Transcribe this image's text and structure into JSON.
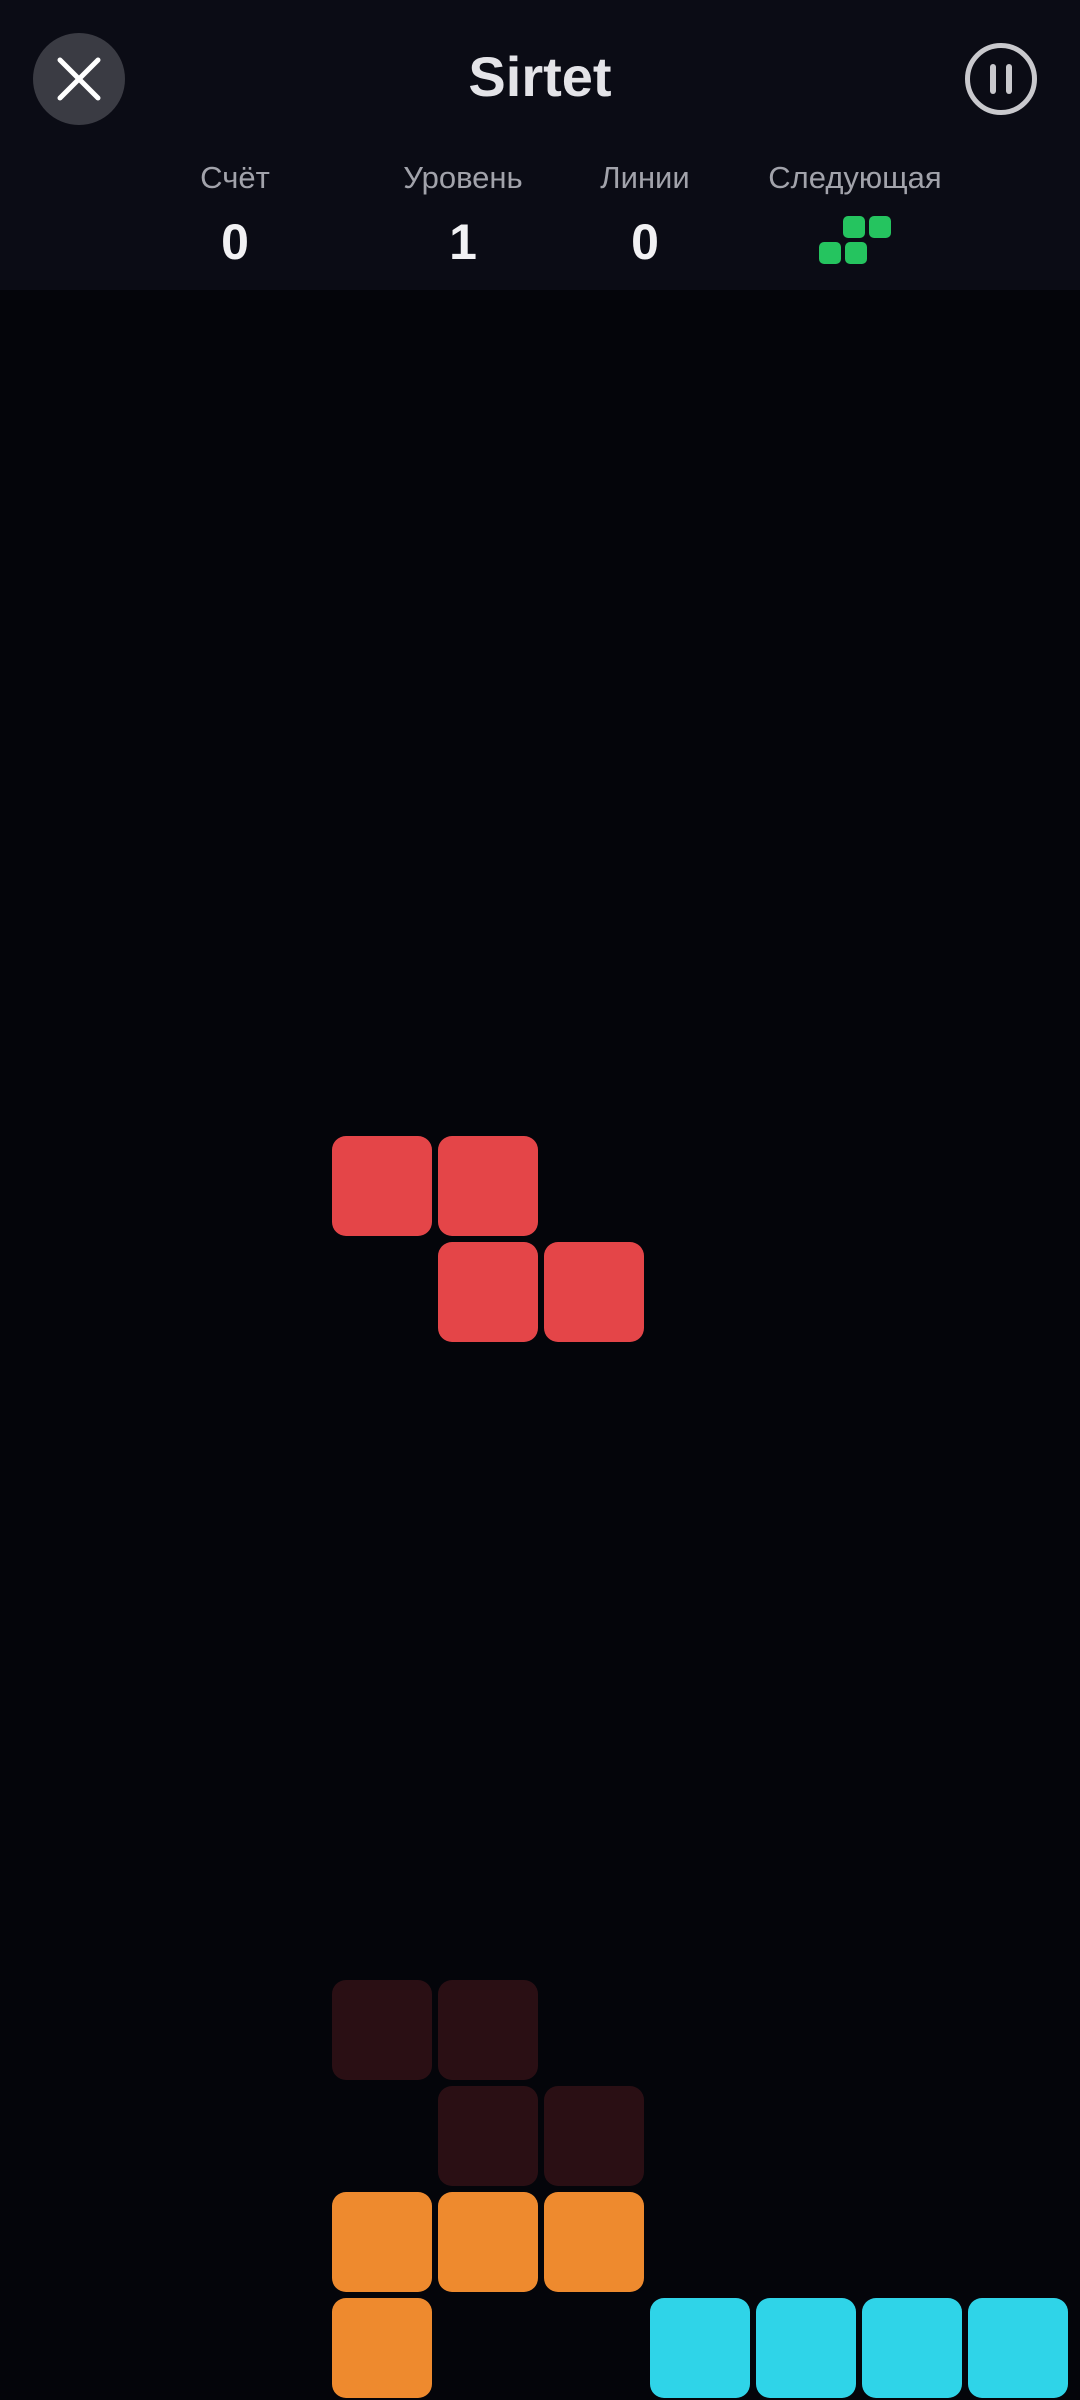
{
  "app": {
    "title": "Sirtet"
  },
  "header": {
    "close_icon": "close-icon",
    "pause_icon": "pause-icon"
  },
  "stats": [
    {
      "label": "Счёт",
      "value": "0"
    },
    {
      "label": "Уровень",
      "value": "1"
    },
    {
      "label": "Линии",
      "value": "0"
    },
    {
      "label": "Следующая"
    }
  ],
  "next_piece": {
    "shape": "S",
    "color": "#25c45f"
  },
  "board": {
    "columns": 10,
    "active_piece": {
      "shape": "Z",
      "color": "#e44548"
    },
    "ghost_piece": {
      "shape": "Z",
      "color": "#2a0f14"
    },
    "settled_blocks": [
      {
        "shape": "L",
        "color": "#ee8a2e"
      },
      {
        "shape": "I",
        "color": "#2fd4e8"
      }
    ]
  }
}
